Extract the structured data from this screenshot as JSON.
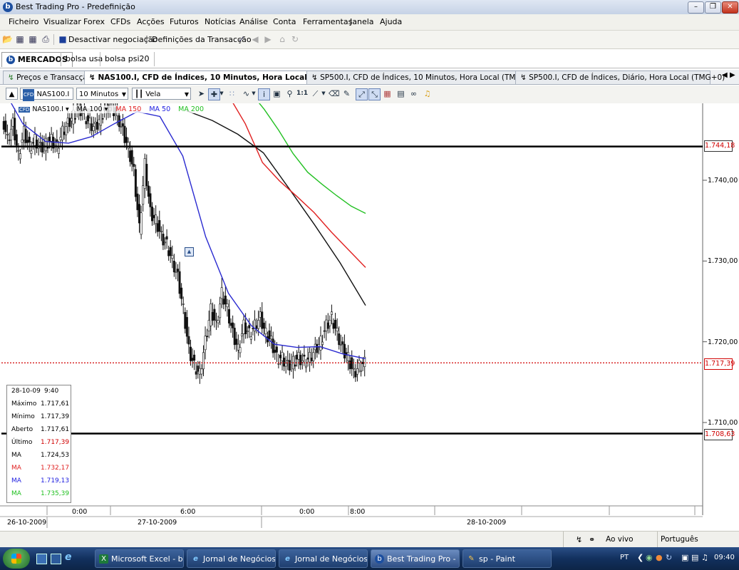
{
  "window": {
    "title": "Best Trading Pro - Predefinição",
    "logo": "b",
    "controls": [
      "minimize-icon",
      "restore-icon",
      "close-icon"
    ]
  },
  "menu": [
    "Ficheiro",
    "Visualizar",
    "Forex",
    "CFDs",
    "Acções",
    "Futuros",
    "Notícias",
    "Análise",
    "Conta",
    "Ferramentas",
    "Janela",
    "Ajuda"
  ],
  "toolbar": {
    "deactivate_label": "Desactivar negociação",
    "settings_label": "Definições da Transacção"
  },
  "workspace_tabs": [
    "MERCADOS",
    "bolsa usa",
    "bolsa psi20"
  ],
  "doc_tabs": [
    "Preços e Transacção",
    "NAS100.I, CFD de Índices, 10 Minutos, Hora Local (TMG+0)",
    "SP500.I, CFD de Índices, 10 Minutos, Hora Local (TMG+0)",
    "SP500.I, CFD de Índices, Diário, Hora Local (TMG+0)"
  ],
  "chart_toolbar": {
    "symbol": "NAS100.I",
    "interval": "10 Minutos",
    "style": "Vela",
    "zoom_label": "1:1"
  },
  "chart_legend": {
    "symbol": "NAS100.I",
    "items": [
      {
        "label": "MA 100",
        "color": "#000000"
      },
      {
        "label": "MA 150",
        "color": "#e02020"
      },
      {
        "label": "MA 50",
        "color": "#2020e0"
      },
      {
        "label": "MA 200",
        "color": "#20c020"
      }
    ]
  },
  "chart_data": {
    "type": "line",
    "y_ticks": [
      "1.740,00",
      "1.730,00",
      "1.720,00",
      "1.710,00"
    ],
    "ylim": [
      1700.5,
      1752.5
    ],
    "horizontal_lines": [
      {
        "label": "1.744,18",
        "value": 1744.18,
        "style": "solid"
      },
      {
        "label": "1.717,39",
        "value": 1717.39,
        "style": "dotted",
        "color": "#d00000"
      },
      {
        "label": "1.708,63",
        "value": 1708.63,
        "style": "solid"
      }
    ],
    "x_time_labels": [
      "0:00",
      "6:00",
      "0:00",
      "8:00"
    ],
    "x_date_labels": [
      "26-10-2009",
      "27-10-2009",
      "28-10-2009"
    ],
    "series": [
      {
        "name": "MA 50",
        "color": "#2a2ad0",
        "values": [
          1752,
          1747,
          1744.8,
          1744.6,
          1745.4,
          1747,
          1748.5,
          1747.9,
          1743,
          1733,
          1726,
          1722,
          1719.7,
          1719.3,
          1719.4,
          1718.5,
          1717.9
        ]
      },
      {
        "name": "MA 100",
        "color": "#111111",
        "values": [
          1748.6,
          1747.4,
          1745.7,
          1743.4,
          1739,
          1734.5,
          1729.8,
          1724.5
        ]
      },
      {
        "name": "MA 150",
        "color": "#e02020",
        "values": [
          1752.4,
          1750.6,
          1747,
          1742.2,
          1739.9,
          1738,
          1736,
          1733.6,
          1731.4,
          1729.2
        ]
      },
      {
        "name": "MA 200",
        "color": "#22c022",
        "values": [
          1752.2,
          1751,
          1748.8,
          1746.2,
          1743.3,
          1741,
          1739.5,
          1738.1,
          1736.8,
          1735.9
        ]
      }
    ],
    "price_path": [
      1748,
      1745,
      1747,
      1743,
      1746,
      1744,
      1745,
      1744,
      1744.5,
      1745,
      1744,
      1746,
      1747,
      1748,
      1749,
      1748,
      1747,
      1746.5,
      1748,
      1749,
      1749,
      1748,
      1746,
      1744,
      1741,
      1734,
      1742,
      1736,
      1735,
      1733,
      1732,
      1730,
      1728,
      1724,
      1719,
      1717,
      1716,
      1720,
      1724,
      1722,
      1726,
      1724,
      1721,
      1719,
      1722,
      1721,
      1722,
      1723,
      1721,
      1720,
      1718,
      1718,
      1717,
      1717.5,
      1718,
      1717.5,
      1718,
      1719,
      1720,
      1722,
      1723,
      1721,
      1719,
      1718,
      1716,
      1717,
      1717.4
    ],
    "legend_placement": "top-left"
  },
  "info_box": {
    "date": "28-10-09",
    "time": "9:40",
    "rows": [
      {
        "key": "Máximo",
        "value": "1.717,61",
        "color": "#000000"
      },
      {
        "key": "Mínimo",
        "value": "1.717,39",
        "color": "#000000"
      },
      {
        "key": "Aberto",
        "value": "1.717,61",
        "color": "#000000"
      },
      {
        "key": "Último",
        "value": "1.717,39",
        "color": "#d00000"
      },
      {
        "key": "MA",
        "value": "1.724,53",
        "color": "#000000"
      },
      {
        "key": "MA",
        "value": "1.732,17",
        "color": "#e02020"
      },
      {
        "key": "MA",
        "value": "1.719,13",
        "color": "#2020e0"
      },
      {
        "key": "MA",
        "value": "1.735,39",
        "color": "#20c020"
      }
    ]
  },
  "statusbar": {
    "live": "Ao vivo",
    "language": "Português"
  },
  "taskbar": {
    "items": [
      {
        "label": "Microsoft Excel - bo...",
        "icon": "excel-icon"
      },
      {
        "label": "Jornal de Negócios/...",
        "icon": "ie-icon"
      },
      {
        "label": "Jornal de Negócios ...",
        "icon": "ie-icon"
      },
      {
        "label": "Best Trading Pro - P...",
        "icon": "btp-icon"
      },
      {
        "label": "sp - Paint",
        "icon": "paint-icon"
      }
    ],
    "lang": "PT",
    "clock": "09:40"
  }
}
